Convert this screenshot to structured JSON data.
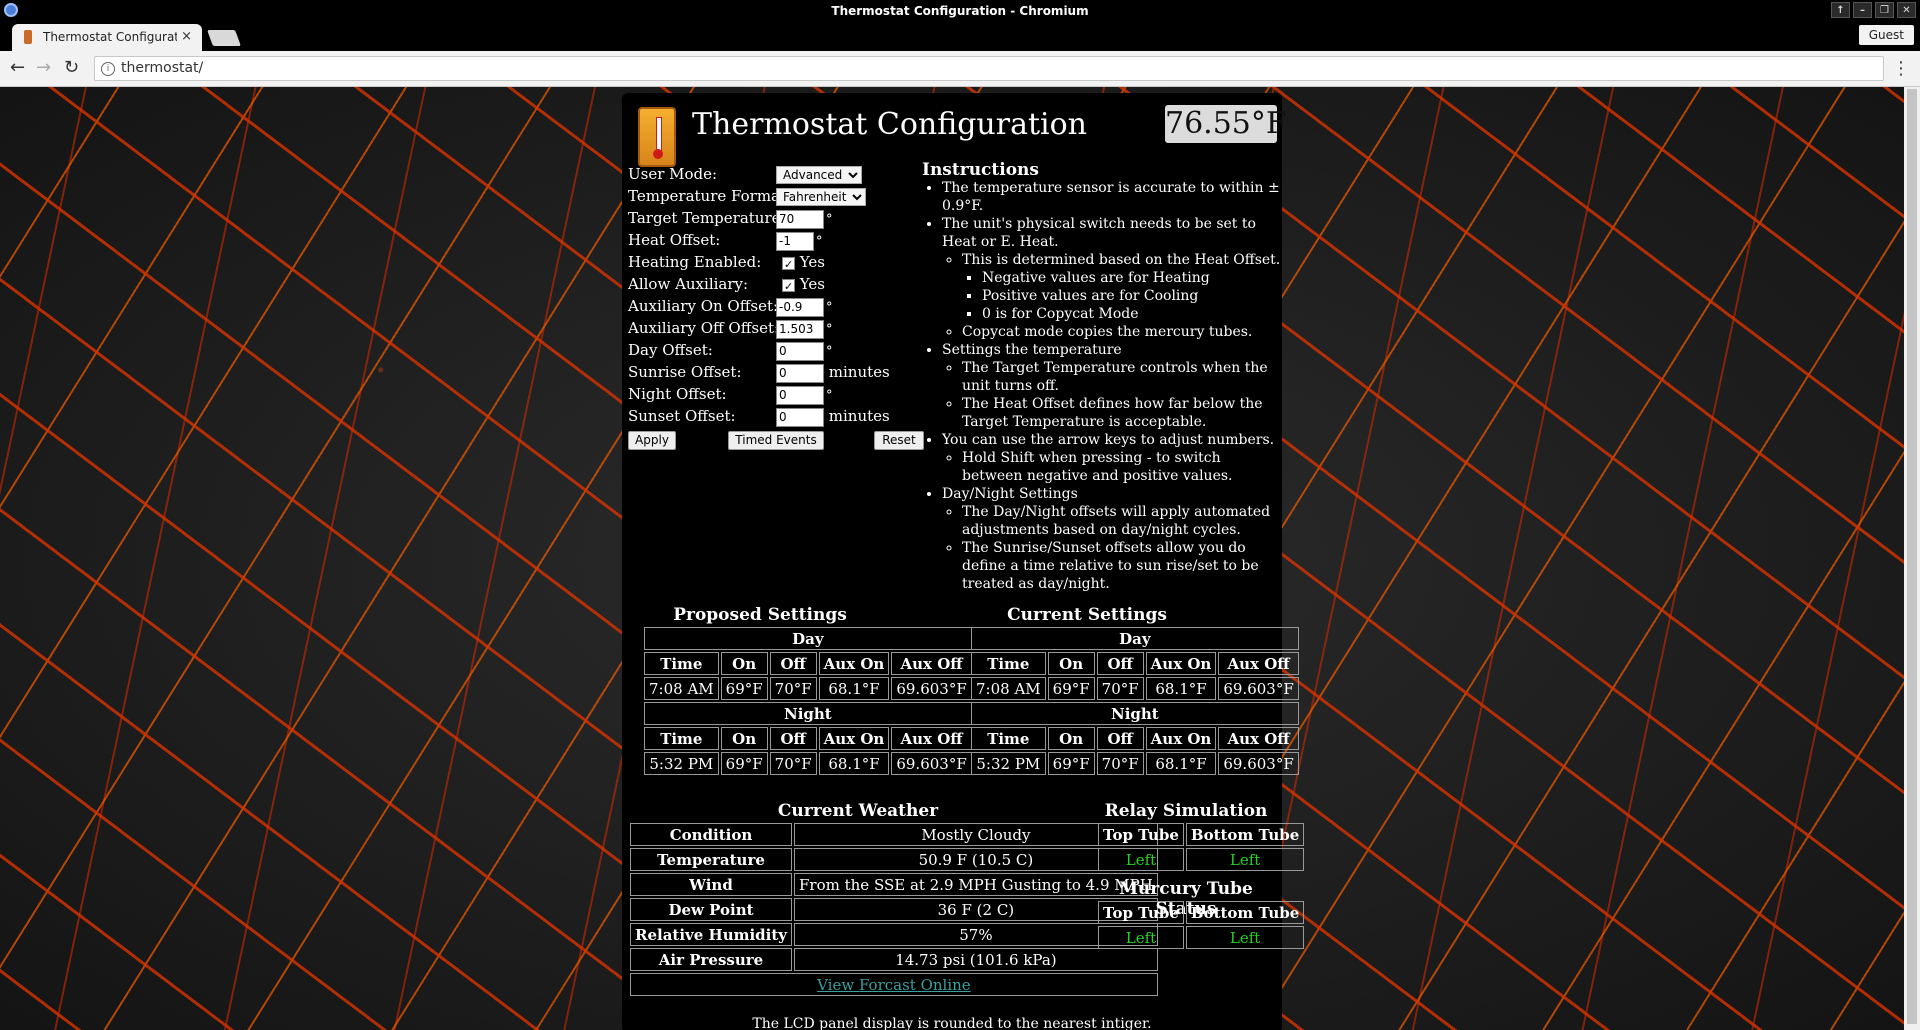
{
  "window": {
    "title": "Thermostat Configuration - Chromium",
    "buttons": [
      "↑",
      "–",
      "❐",
      "✕"
    ]
  },
  "tab": {
    "title": "Thermostat Configuration",
    "close": "×"
  },
  "profile": {
    "label": "Guest"
  },
  "address_bar": {
    "url": "thermostat/"
  },
  "header": {
    "title": "Thermostat Configuration",
    "lcd": "76.55°F"
  },
  "form": {
    "user_mode": {
      "label": "User Mode:",
      "value": "Advanced"
    },
    "temperature_format": {
      "label": "Temperature Format:",
      "value": "Fahrenheit"
    },
    "target_temperature": {
      "label": "Target Temperature:",
      "value": "70",
      "unit": "°"
    },
    "heat_offset": {
      "label": "Heat Offset:",
      "value": "-1",
      "unit": "°"
    },
    "heating_enabled": {
      "label": "Heating Enabled:",
      "checked": true,
      "text": "Yes"
    },
    "allow_auxiliary": {
      "label": "Allow Auxiliary:",
      "checked": true,
      "text": "Yes"
    },
    "aux_on_offset": {
      "label": "Auxiliary On Offset:",
      "value": "-0.9",
      "unit": "°"
    },
    "aux_off_offset": {
      "label": "Auxiliary Off Offset:",
      "value": "1.503",
      "unit": "°"
    },
    "day_offset": {
      "label": "Day Offset:",
      "value": "0",
      "unit": "°"
    },
    "sunrise_offset": {
      "label": "Sunrise Offset:",
      "value": "0",
      "unit": "minutes"
    },
    "night_offset": {
      "label": "Night Offset:",
      "value": "0",
      "unit": "°"
    },
    "sunset_offset": {
      "label": "Sunset Offset:",
      "value": "0",
      "unit": "minutes"
    },
    "buttons": {
      "apply": "Apply",
      "timed_events": "Timed Events",
      "reset": "Reset"
    }
  },
  "instructions": {
    "title": "Instructions",
    "b1": "The temperature sensor is accurate to within ± 0.9°F.",
    "b2": "The unit's physical switch needs to be set to Heat or E. Heat.",
    "b2_1": "This is determined based on the Heat Offset.",
    "b2_1_1": "Negative values are for Heating",
    "b2_1_2": "Positive values are for Cooling",
    "b2_1_3": "0 is for Copycat Mode",
    "b2_2": "Copycat mode copies the mercury tubes.",
    "b3": "Settings the temperature",
    "b3_1": "The Target Temperature controls when the unit turns off.",
    "b3_2": "The Heat Offset defines how far below the Target Temperature is acceptable.",
    "b4": "You can use the arrow keys to adjust numbers.",
    "b4_1": "Hold Shift when pressing - to switch between negative and positive values.",
    "b5": "Day/Night Settings",
    "b5_1": "The Day/Night offsets will apply automated adjustments based on day/night cycles.",
    "b5_2": "The Sunrise/Sunset offsets allow you do define a time relative to sun rise/set to be treated as day/night."
  },
  "settings_headers": {
    "day": "Day",
    "night": "Night",
    "cols": [
      "Time",
      "On",
      "Off",
      "Aux On",
      "Aux Off"
    ]
  },
  "proposed": {
    "title": "Proposed Settings",
    "day": [
      "7:08 AM",
      "69°F",
      "70°F",
      "68.1°F",
      "69.603°F"
    ],
    "night": [
      "5:32 PM",
      "69°F",
      "70°F",
      "68.1°F",
      "69.603°F"
    ]
  },
  "current": {
    "title": "Current Settings",
    "day": [
      "7:08 AM",
      "69°F",
      "70°F",
      "68.1°F",
      "69.603°F"
    ],
    "night": [
      "5:32 PM",
      "69°F",
      "70°F",
      "68.1°F",
      "69.603°F"
    ]
  },
  "weather": {
    "title": "Current Weather",
    "rows": [
      [
        "Condition",
        "Mostly Cloudy"
      ],
      [
        "Temperature",
        "50.9 F (10.5 C)"
      ],
      [
        "Wind",
        "From the SSE at 2.9 MPH Gusting to 4.9 MPH"
      ],
      [
        "Dew Point",
        "36 F (2 C)"
      ],
      [
        "Relative Humidity",
        "57%"
      ],
      [
        "Air Pressure",
        "14.73 psi (101.6 kPa)"
      ]
    ],
    "link": "View Forcast Online"
  },
  "relay": {
    "title": "Relay Simulation",
    "cols": [
      "Top Tube",
      "Bottom Tube"
    ],
    "values": [
      "Left",
      "Left"
    ]
  },
  "mercury": {
    "title": "Murcury Tube Status",
    "cols": [
      "Top Tube",
      "Bottom Tube"
    ],
    "values": [
      "Left",
      "Left"
    ]
  },
  "footnote": "The LCD panel display is rounded to the nearest intiger."
}
